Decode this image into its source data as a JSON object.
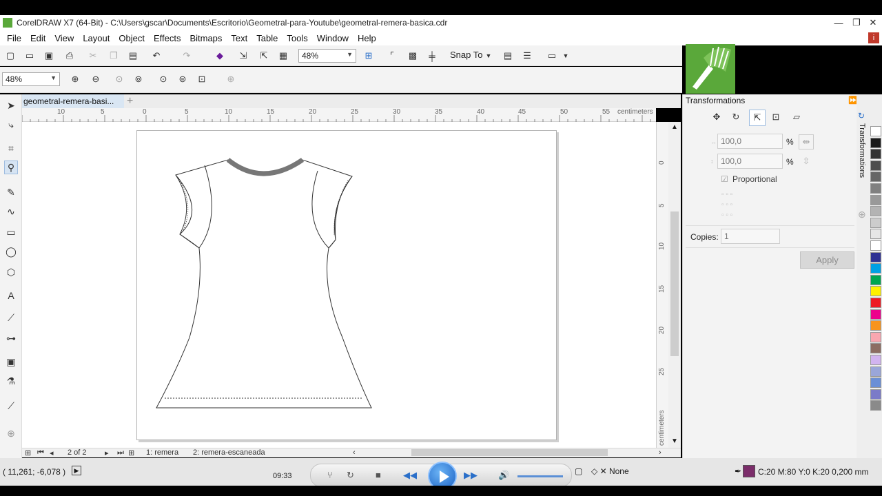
{
  "window": {
    "title": "CorelDRAW X7 (64-Bit) - C:\\Users\\gscar\\Documents\\Escritorio\\Geometral-para-Youtube\\geometral-remera-basica.cdr",
    "minimize": "—",
    "restore": "❐",
    "close": "✕"
  },
  "menu": [
    "File",
    "Edit",
    "View",
    "Layout",
    "Object",
    "Effects",
    "Bitmaps",
    "Text",
    "Table",
    "Tools",
    "Window",
    "Help"
  ],
  "toolbar": {
    "zoom_value": "48%",
    "snap_to": "Snap To"
  },
  "property_bar": {
    "zoom_value": "48%"
  },
  "document": {
    "tab_name": "geometral-remera-basi...",
    "ruler_units": "centimeters",
    "hruler_labels": [
      "10",
      "5",
      "0",
      "5",
      "10",
      "15",
      "20",
      "25",
      "30",
      "35",
      "40",
      "45",
      "50",
      "55"
    ],
    "vruler_labels": [
      "0",
      "5",
      "10",
      "15",
      "20",
      "25"
    ],
    "vruler_units": "centimeters",
    "page_counter": "2 of 2",
    "pages": [
      "1: remera",
      "2: remera-escaneada"
    ]
  },
  "docker": {
    "title": "Transformations",
    "tab_label": "Transformations",
    "x_value": "100,0",
    "y_value": "100,0",
    "percent": "%",
    "proportional": "Proportional",
    "copies_label": "Copies:",
    "copies_value": "1",
    "apply": "Apply"
  },
  "palette": [
    "#ffffff",
    "#1a1a1a",
    "#333333",
    "#4d4d4d",
    "#666666",
    "#808080",
    "#999999",
    "#b3b3b3",
    "#cccccc",
    "#e6e6e6",
    "#ffffff",
    "#2e3192",
    "#00a0e3",
    "#00a651",
    "#fff200",
    "#ed1c24",
    "#ec008c",
    "#f7941d",
    "#f9a7b0",
    "#8c6d62",
    "#d2b4f0",
    "#9aa6d9",
    "#6b8fd6",
    "#7b7bc8",
    "#8a8a8a"
  ],
  "status": {
    "coords": "( 11,261; -6,078 )",
    "time": "09:33",
    "fill": "None",
    "outline": "C:20 M:80 Y:0 K:20  0,200 mm",
    "outline_color": "#7b2d6a"
  }
}
